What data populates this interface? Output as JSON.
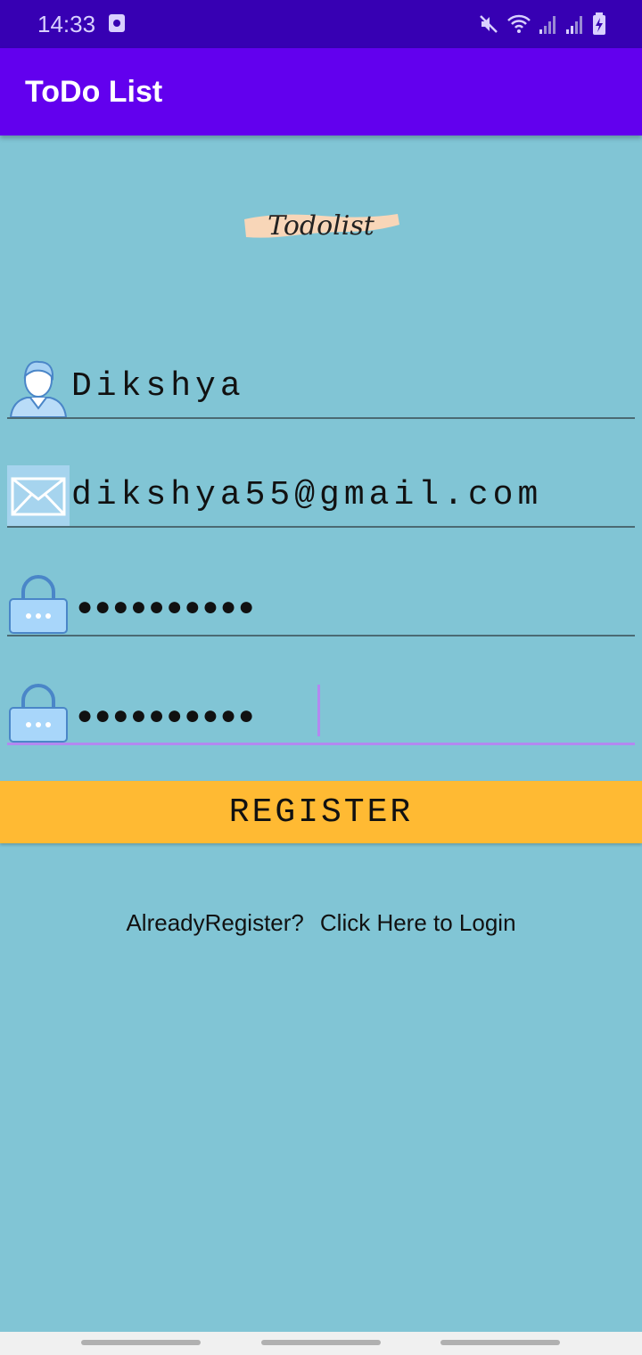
{
  "status_bar": {
    "time": "14:33",
    "icons": [
      "alarm-icon",
      "mute-icon",
      "wifi-icon",
      "signal-icon",
      "signal-icon",
      "battery-charging-icon"
    ]
  },
  "app_bar": {
    "title": "ToDo List"
  },
  "logo": {
    "text": "Todolist"
  },
  "form": {
    "username": {
      "value": "Dikshya",
      "icon": "user-icon"
    },
    "email": {
      "value": "dikshya55@gmail.com",
      "icon": "email-icon"
    },
    "password": {
      "value": "●●●●●●●●●●",
      "icon": "lock-icon"
    },
    "confirm_password": {
      "value": "●●●●●●●●●●",
      "icon": "lock-icon"
    }
  },
  "register_button": {
    "label": "REGISTER"
  },
  "login_prompt": {
    "question": "AlreadyRegister?",
    "link": "Click Here to Login"
  },
  "colors": {
    "background": "#81C5D5",
    "app_bar": "#6200EE",
    "status_bar": "#3700B3",
    "button": "#FFBA33",
    "focus": "#B388F0"
  }
}
